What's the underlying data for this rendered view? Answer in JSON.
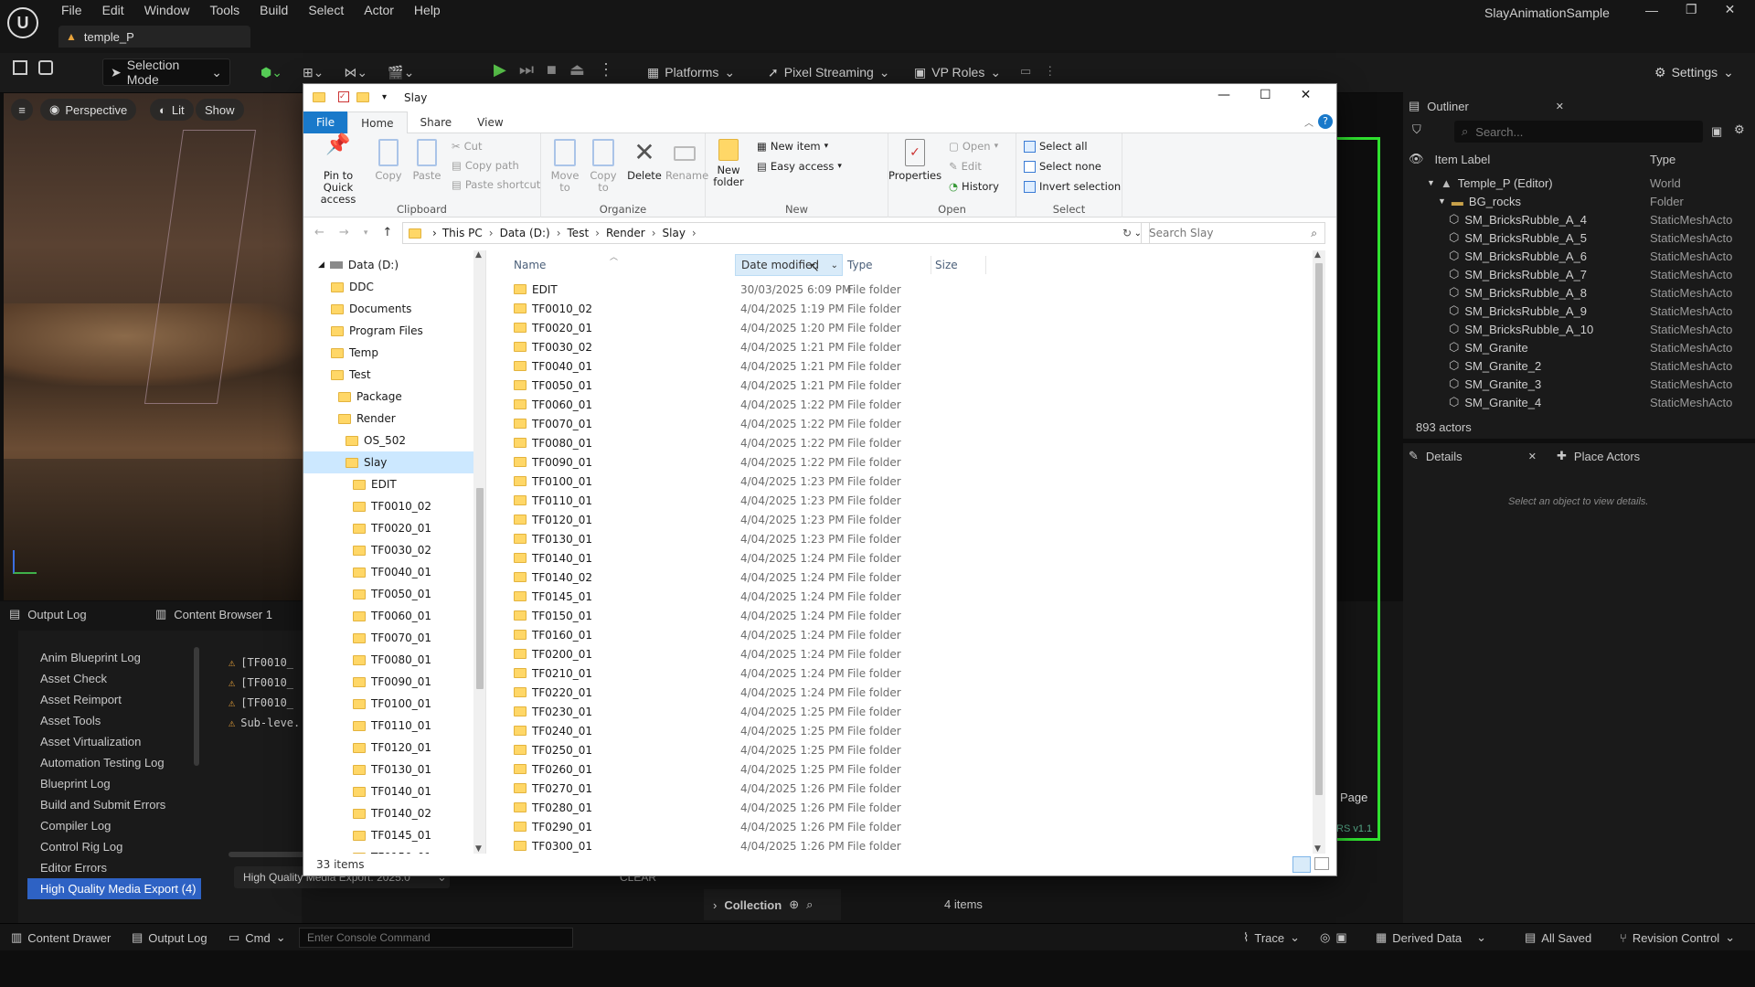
{
  "ue": {
    "project": "SlayAnimationSample",
    "menu": [
      "File",
      "Edit",
      "Window",
      "Tools",
      "Build",
      "Select",
      "Actor",
      "Help"
    ],
    "level_tab": "temple_P",
    "toolbar": {
      "selection_mode": "Selection Mode",
      "platforms": "Platforms",
      "pixel_streaming": "Pixel Streaming",
      "vp_roles": "VP Roles",
      "settings": "Settings"
    },
    "viewport": {
      "perspective": "Perspective",
      "lit": "Lit",
      "show": "Show"
    },
    "bottom_tabs": {
      "output_log": "Output Log",
      "content_browser": "Content Browser 1"
    },
    "log_categories": [
      "Anim Blueprint Log",
      "Asset Check",
      "Asset Reimport",
      "Asset Tools",
      "Asset Virtualization",
      "Automation Testing Log",
      "Blueprint Log",
      "Build and Submit Errors",
      "Compiler Log",
      "Control Rig Log",
      "Editor Errors",
      "High Quality Media Export (4)"
    ],
    "log_lines": [
      "[TF0010_",
      "[TF0010_",
      "[TF0010_",
      "Sub-leve."
    ],
    "log_filter": "High Quality Media Export: 2025.0",
    "clear": "CLEAR",
    "collection": "Collection",
    "items_count": "4 items",
    "page_btn": "Page",
    "version": "RS v1.1",
    "statusbar": {
      "content_drawer": "Content Drawer",
      "output_log": "Output Log",
      "cmd": "Cmd",
      "console_placeholder": "Enter Console Command",
      "trace": "Trace",
      "derived_data": "Derived Data",
      "all_saved": "All Saved",
      "revision_control": "Revision Control"
    },
    "outliner": {
      "title": "Outliner",
      "search": "Search...",
      "col_label": "Item Label",
      "col_type": "Type",
      "rows": [
        {
          "label": "Temple_P (Editor)",
          "type": "World",
          "indent": 1
        },
        {
          "label": "BG_rocks",
          "type": "Folder",
          "indent": 2
        },
        {
          "label": "SM_BricksRubble_A_4",
          "type": "StaticMeshActo",
          "indent": 3
        },
        {
          "label": "SM_BricksRubble_A_5",
          "type": "StaticMeshActo",
          "indent": 3
        },
        {
          "label": "SM_BricksRubble_A_6",
          "type": "StaticMeshActo",
          "indent": 3
        },
        {
          "label": "SM_BricksRubble_A_7",
          "type": "StaticMeshActo",
          "indent": 3
        },
        {
          "label": "SM_BricksRubble_A_8",
          "type": "StaticMeshActo",
          "indent": 3
        },
        {
          "label": "SM_BricksRubble_A_9",
          "type": "StaticMeshActo",
          "indent": 3
        },
        {
          "label": "SM_BricksRubble_A_10",
          "type": "StaticMeshActo",
          "indent": 3
        },
        {
          "label": "SM_Granite",
          "type": "StaticMeshActo",
          "indent": 3
        },
        {
          "label": "SM_Granite_2",
          "type": "StaticMeshActo",
          "indent": 3
        },
        {
          "label": "SM_Granite_3",
          "type": "StaticMeshActo",
          "indent": 3
        },
        {
          "label": "SM_Granite_4",
          "type": "StaticMeshActo",
          "indent": 3
        }
      ],
      "actors": "893 actors"
    },
    "details": {
      "title": "Details",
      "place_actors": "Place Actors",
      "empty": "Select an object to view details."
    }
  },
  "explorer": {
    "title": "Slay",
    "tabs": [
      "File",
      "Home",
      "Share",
      "View"
    ],
    "ribbon": {
      "pin": "Pin to Quick access",
      "copy": "Copy",
      "paste": "Paste",
      "cut": "Cut",
      "copy_path": "Copy path",
      "paste_shortcut": "Paste shortcut",
      "clipboard": "Clipboard",
      "move_to": "Move to",
      "copy_to": "Copy to",
      "delete": "Delete",
      "rename": "Rename",
      "organize": "Organize",
      "new_folder": "New folder",
      "new_item": "New item",
      "easy_access": "Easy access",
      "new": "New",
      "properties": "Properties",
      "open": "Open",
      "edit": "Edit",
      "history": "History",
      "open_group": "Open",
      "select_all": "Select all",
      "select_none": "Select none",
      "invert_selection": "Invert selection",
      "select": "Select"
    },
    "address": [
      "This PC",
      "Data (D:)",
      "Test",
      "Render",
      "Slay"
    ],
    "search_placeholder": "Search Slay",
    "nav": [
      {
        "label": "Data (D:)",
        "level": 0,
        "drive": true
      },
      {
        "label": "DDC",
        "level": 1
      },
      {
        "label": "Documents",
        "level": 1
      },
      {
        "label": "Program Files",
        "level": 1
      },
      {
        "label": "Temp",
        "level": 1
      },
      {
        "label": "Test",
        "level": 1
      },
      {
        "label": "Package",
        "level": 2
      },
      {
        "label": "Render",
        "level": 2
      },
      {
        "label": "OS_502",
        "level": 3
      },
      {
        "label": "Slay",
        "level": 3,
        "selected": true
      },
      {
        "label": "EDIT",
        "level": 4
      },
      {
        "label": "TF0010_02",
        "level": 4
      },
      {
        "label": "TF0020_01",
        "level": 4
      },
      {
        "label": "TF0030_02",
        "level": 4
      },
      {
        "label": "TF0040_01",
        "level": 4
      },
      {
        "label": "TF0050_01",
        "level": 4
      },
      {
        "label": "TF0060_01",
        "level": 4
      },
      {
        "label": "TF0070_01",
        "level": 4
      },
      {
        "label": "TF0080_01",
        "level": 4
      },
      {
        "label": "TF0090_01",
        "level": 4
      },
      {
        "label": "TF0100_01",
        "level": 4
      },
      {
        "label": "TF0110_01",
        "level": 4
      },
      {
        "label": "TF0120_01",
        "level": 4
      },
      {
        "label": "TF0130_01",
        "level": 4
      },
      {
        "label": "TF0140_01",
        "level": 4
      },
      {
        "label": "TF0140_02",
        "level": 4
      },
      {
        "label": "TF0145_01",
        "level": 4
      },
      {
        "label": "TF0150_01",
        "level": 4
      }
    ],
    "columns": {
      "name": "Name",
      "date": "Date modified",
      "type": "Type",
      "size": "Size"
    },
    "files": [
      {
        "name": "EDIT",
        "date": "30/03/2025 6:09 PM",
        "type": "File folder"
      },
      {
        "name": "TF0010_02",
        "date": "4/04/2025 1:19 PM",
        "type": "File folder"
      },
      {
        "name": "TF0020_01",
        "date": "4/04/2025 1:20 PM",
        "type": "File folder"
      },
      {
        "name": "TF0030_02",
        "date": "4/04/2025 1:21 PM",
        "type": "File folder"
      },
      {
        "name": "TF0040_01",
        "date": "4/04/2025 1:21 PM",
        "type": "File folder"
      },
      {
        "name": "TF0050_01",
        "date": "4/04/2025 1:21 PM",
        "type": "File folder"
      },
      {
        "name": "TF0060_01",
        "date": "4/04/2025 1:22 PM",
        "type": "File folder"
      },
      {
        "name": "TF0070_01",
        "date": "4/04/2025 1:22 PM",
        "type": "File folder"
      },
      {
        "name": "TF0080_01",
        "date": "4/04/2025 1:22 PM",
        "type": "File folder"
      },
      {
        "name": "TF0090_01",
        "date": "4/04/2025 1:22 PM",
        "type": "File folder"
      },
      {
        "name": "TF0100_01",
        "date": "4/04/2025 1:23 PM",
        "type": "File folder"
      },
      {
        "name": "TF0110_01",
        "date": "4/04/2025 1:23 PM",
        "type": "File folder"
      },
      {
        "name": "TF0120_01",
        "date": "4/04/2025 1:23 PM",
        "type": "File folder"
      },
      {
        "name": "TF0130_01",
        "date": "4/04/2025 1:23 PM",
        "type": "File folder"
      },
      {
        "name": "TF0140_01",
        "date": "4/04/2025 1:24 PM",
        "type": "File folder"
      },
      {
        "name": "TF0140_02",
        "date": "4/04/2025 1:24 PM",
        "type": "File folder"
      },
      {
        "name": "TF0145_01",
        "date": "4/04/2025 1:24 PM",
        "type": "File folder"
      },
      {
        "name": "TF0150_01",
        "date": "4/04/2025 1:24 PM",
        "type": "File folder"
      },
      {
        "name": "TF0160_01",
        "date": "4/04/2025 1:24 PM",
        "type": "File folder"
      },
      {
        "name": "TF0200_01",
        "date": "4/04/2025 1:24 PM",
        "type": "File folder"
      },
      {
        "name": "TF0210_01",
        "date": "4/04/2025 1:24 PM",
        "type": "File folder"
      },
      {
        "name": "TF0220_01",
        "date": "4/04/2025 1:24 PM",
        "type": "File folder"
      },
      {
        "name": "TF0230_01",
        "date": "4/04/2025 1:25 PM",
        "type": "File folder"
      },
      {
        "name": "TF0240_01",
        "date": "4/04/2025 1:25 PM",
        "type": "File folder"
      },
      {
        "name": "TF0250_01",
        "date": "4/04/2025 1:25 PM",
        "type": "File folder"
      },
      {
        "name": "TF0260_01",
        "date": "4/04/2025 1:25 PM",
        "type": "File folder"
      },
      {
        "name": "TF0270_01",
        "date": "4/04/2025 1:26 PM",
        "type": "File folder"
      },
      {
        "name": "TF0280_01",
        "date": "4/04/2025 1:26 PM",
        "type": "File folder"
      },
      {
        "name": "TF0290_01",
        "date": "4/04/2025 1:26 PM",
        "type": "File folder"
      },
      {
        "name": "TF0300_01",
        "date": "4/04/2025 1:26 PM",
        "type": "File folder"
      }
    ],
    "status": "33 items",
    "colors": {
      "accent": "#1979ca",
      "selected": "#cce8ff",
      "folder": "#ffd767"
    }
  }
}
